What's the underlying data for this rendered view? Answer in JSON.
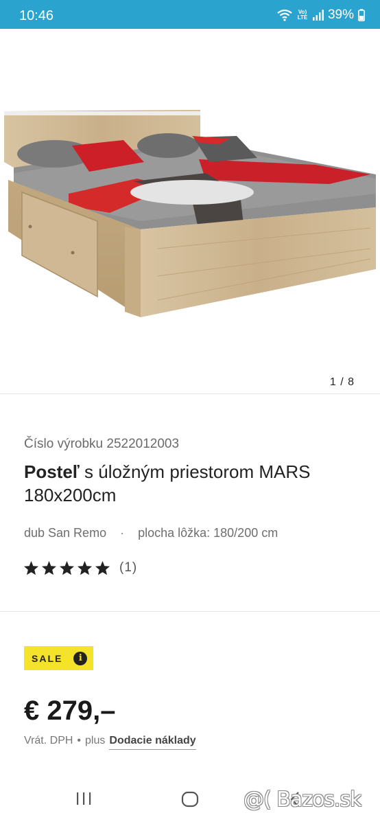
{
  "status_bar": {
    "time": "10:46",
    "lte_label": "Vo) LTE",
    "battery_percent": "39%",
    "icons": [
      "wifi-icon",
      "lte-icon",
      "signal-icon",
      "battery-icon"
    ]
  },
  "gallery": {
    "image_description_icon": "bed-photo",
    "counter": "1 / 8"
  },
  "product": {
    "number_label": "Číslo výrobku 2522012003",
    "title_bold": "Posteľ",
    "title_rest": " s úložným priestorom MARS 180x200cm",
    "attr_color": "dub San Remo",
    "attr_separator": "·",
    "attr_size": "plocha lôžka: 180/200 cm",
    "rating_stars": 5,
    "rating_count": "(1)"
  },
  "pricing": {
    "sale_label": "SALE",
    "info_glyph": "i",
    "price": "€ 279,–",
    "vat_note": "Vrát. DPH",
    "bullet": "•",
    "plus": "plus",
    "shipping_link": "Dodacie náklady"
  },
  "nav_bar": {
    "buttons": [
      "recent-apps-icon",
      "home-icon",
      "back-icon"
    ],
    "watermark": "@( Bazos.sk"
  },
  "colors": {
    "status_bar": "#2aa4cf",
    "sale_badge": "#f5e22b",
    "text_dark": "#222222"
  }
}
